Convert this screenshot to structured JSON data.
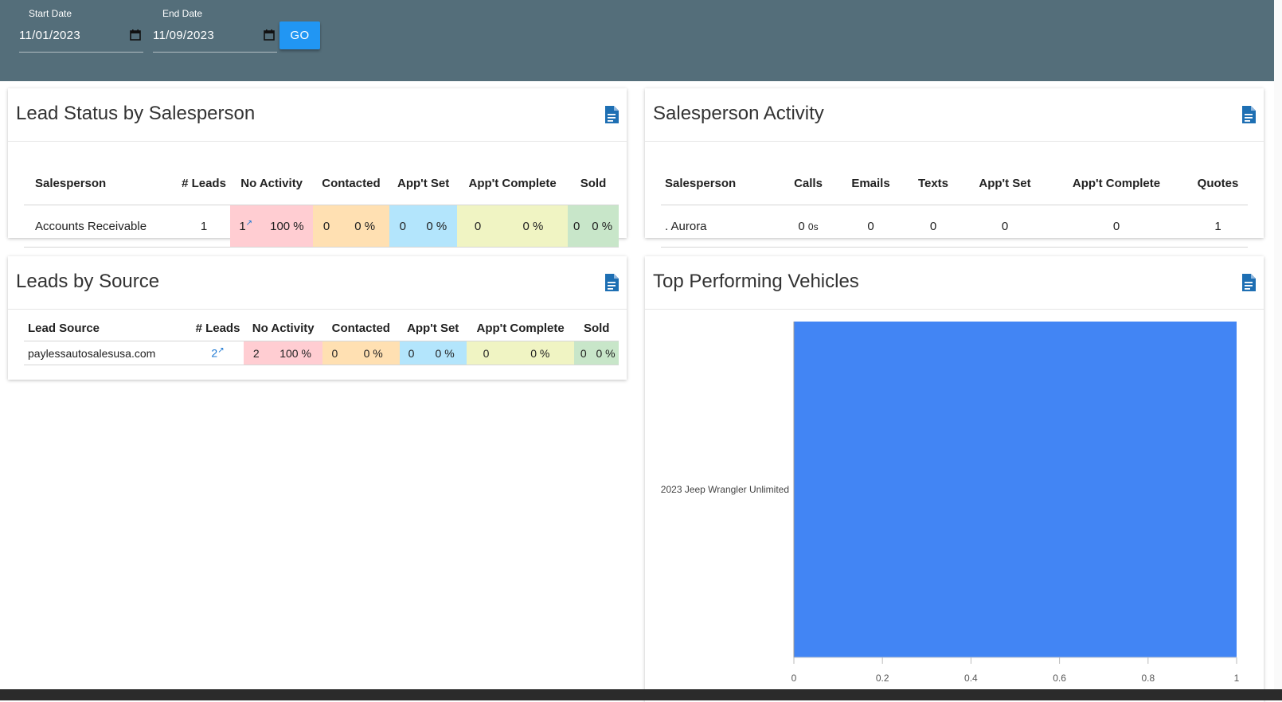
{
  "filters": {
    "start_label": "Start Date",
    "start_value": "11/01/2023",
    "end_label": "End Date",
    "end_value": "11/09/2023",
    "go_label": "GO"
  },
  "lead_status": {
    "title": "Lead Status by Salesperson",
    "headers": [
      "Salesperson",
      "# Leads",
      "No Activity",
      "Contacted",
      "App't Set",
      "App't Complete",
      "Sold"
    ],
    "row": {
      "name": "Accounts Receivable",
      "leads": "1",
      "no_activity": "1",
      "no_activity_pct": "100 %",
      "contacted": "0",
      "contacted_pct": "0 %",
      "appt_set": "0",
      "appt_set_pct": "0 %",
      "appt_complete": "0",
      "appt_complete_pct": "0 %",
      "sold": "0",
      "sold_pct": "0 %"
    }
  },
  "activity": {
    "title": "Salesperson Activity",
    "headers": [
      "Salesperson",
      "Calls",
      "Emails",
      "Texts",
      "App't Set",
      "App't Complete",
      "Quotes"
    ],
    "row": {
      "name": ". Aurora",
      "calls": "0",
      "calls_duration": "0s",
      "emails": "0",
      "texts": "0",
      "appt_set": "0",
      "appt_complete": "0",
      "quotes": "1"
    }
  },
  "source": {
    "title": "Leads by Source",
    "headers": [
      "Lead Source",
      "# Leads",
      "No Activity",
      "Contacted",
      "App't Set",
      "App't Complete",
      "Sold"
    ],
    "row": {
      "name": "paylessautosalesusa.com",
      "leads": "2",
      "no_activity": "2",
      "no_activity_pct": "100 %",
      "contacted": "0",
      "contacted_pct": "0 %",
      "appt_set": "0",
      "appt_set_pct": "0 %",
      "appt_complete": "0",
      "appt_complete_pct": "0 %",
      "sold": "0",
      "sold_pct": "0 %"
    }
  },
  "vehicles": {
    "title": "Top Performing Vehicles"
  },
  "chart_data": {
    "type": "bar",
    "orientation": "horizontal",
    "categories": [
      "2023 Jeep Wrangler Unlimited"
    ],
    "values": [
      1
    ],
    "xlim": [
      0,
      1
    ],
    "xticks": [
      "0",
      "0.2",
      "0.4",
      "0.6",
      "0.8",
      "1"
    ],
    "bar_color": "#4285f4",
    "grid": false
  },
  "colors": {
    "header": "#546e7a",
    "button": "#2196f3",
    "icon": "#1e6fb3",
    "no_activity": "#ffcdd2",
    "contacted": "#ffe0b2",
    "appt_set": "#b3e5fc",
    "appt_complete": "#f0f4c3",
    "sold": "#c8e6c9"
  }
}
